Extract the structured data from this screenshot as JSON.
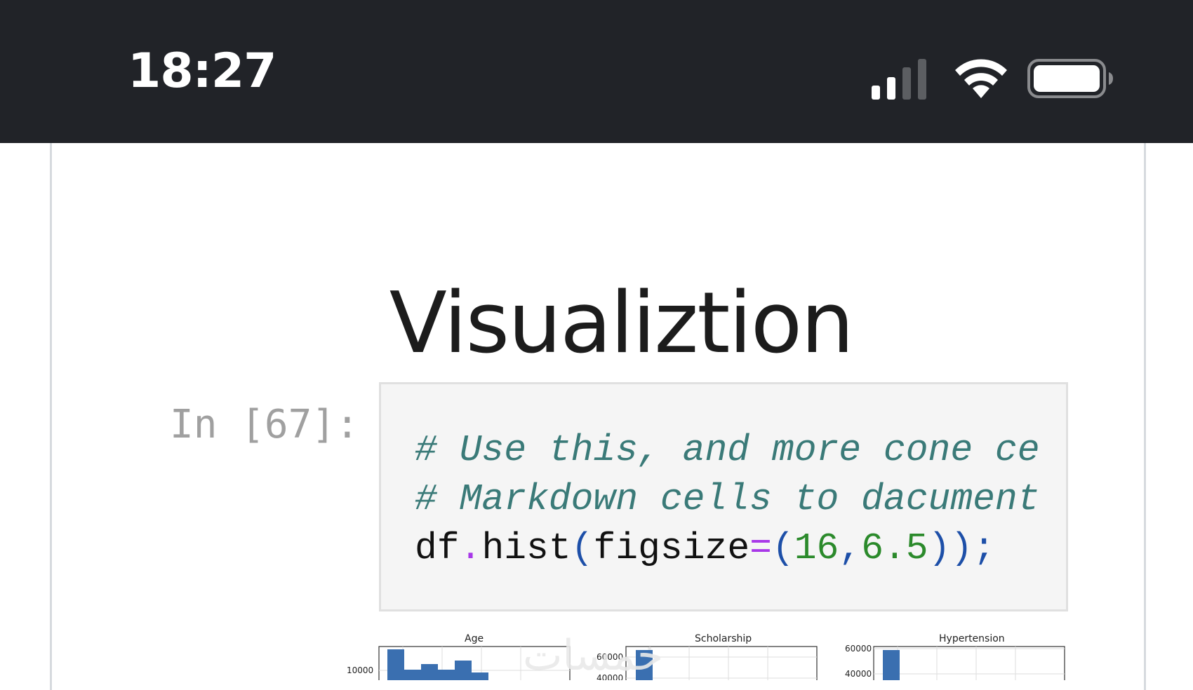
{
  "status_bar": {
    "time": "18:27",
    "icons": [
      "cellular-signal-icon",
      "wifi-icon",
      "battery-icon"
    ]
  },
  "notebook": {
    "heading": "Visualiztion",
    "cell": {
      "prompt": "In [67]:",
      "code": {
        "line1": "# Use this, and more cone ce",
        "line2": "# Markdown cells to dacument",
        "line3_tokens": [
          {
            "text": "df",
            "kind": "plain"
          },
          {
            "text": ".",
            "kind": "op"
          },
          {
            "text": "hist",
            "kind": "plain"
          },
          {
            "text": "(",
            "kind": "paren"
          },
          {
            "text": "figsize",
            "kind": "plain"
          },
          {
            "text": "=",
            "kind": "op"
          },
          {
            "text": "(",
            "kind": "paren"
          },
          {
            "text": "16",
            "kind": "num"
          },
          {
            "text": ",",
            "kind": "paren"
          },
          {
            "text": "6.5",
            "kind": "num"
          },
          {
            "text": ")",
            "kind": "paren"
          },
          {
            "text": ")",
            "kind": "paren"
          },
          {
            "text": ";",
            "kind": "paren"
          }
        ]
      }
    },
    "output": {
      "histograms": [
        {
          "title": "Age",
          "ticks": [
            "10000"
          ]
        },
        {
          "title": "Scholarship",
          "ticks": [
            "60000",
            "40000"
          ]
        },
        {
          "title": "Hypertension",
          "ticks": [
            "60000",
            "40000"
          ]
        }
      ]
    },
    "watermark": "خمسات"
  },
  "colors": {
    "status_bar_bg": "#212328",
    "code_bg": "#f5f5f5",
    "comment": "#3a7a78",
    "operator": "#a838e8",
    "paren": "#1d4fa8",
    "number": "#2b8a2b",
    "bar": "#3a6fb0"
  }
}
